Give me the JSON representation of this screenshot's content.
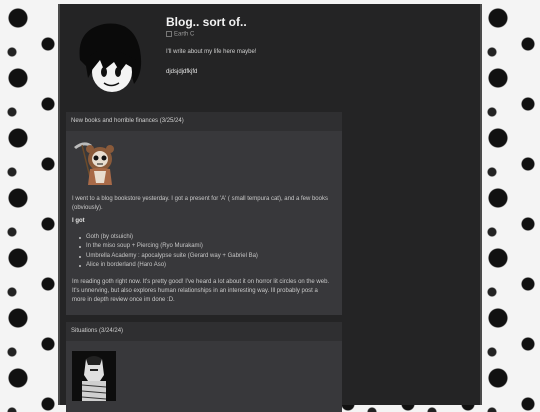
{
  "blog": {
    "title": "Blog.. sort of..",
    "author": "Earth C",
    "description": "I'll write about my life here maybe!",
    "link": "djdsjdjdfkjfd"
  },
  "posts": [
    {
      "title": "New books and horrible finances (3/25/24)",
      "intro": "I went to a blog bookstore yesterday. I got a present for 'A' ( small tempura cat), and a few books (obviously).",
      "subheading": "I got",
      "books": [
        "Goth (by otsuichi)",
        "In the miso soup + Piercing (Ryo Murakami)",
        "Umbrella Academy : apocalypse suite (Gerard way + Gabriel Ba)",
        "Alice in borderland (Haro Aso)"
      ],
      "outro": "Im reading goth right now. It's pretty good! I've heard a lot about it on horror lit circles on the web. It's unnerving, but also explores human relationships in an interesting way. Ill probably post a more in depth review once im done :D."
    },
    {
      "title": "Situations (3/24/24)"
    }
  ],
  "colors": {
    "page_bg": "#242425",
    "post_bg": "#38383b",
    "post_header_bg": "#2f2f31",
    "text": "#c9c9c9",
    "title": "#f2f2f2"
  }
}
